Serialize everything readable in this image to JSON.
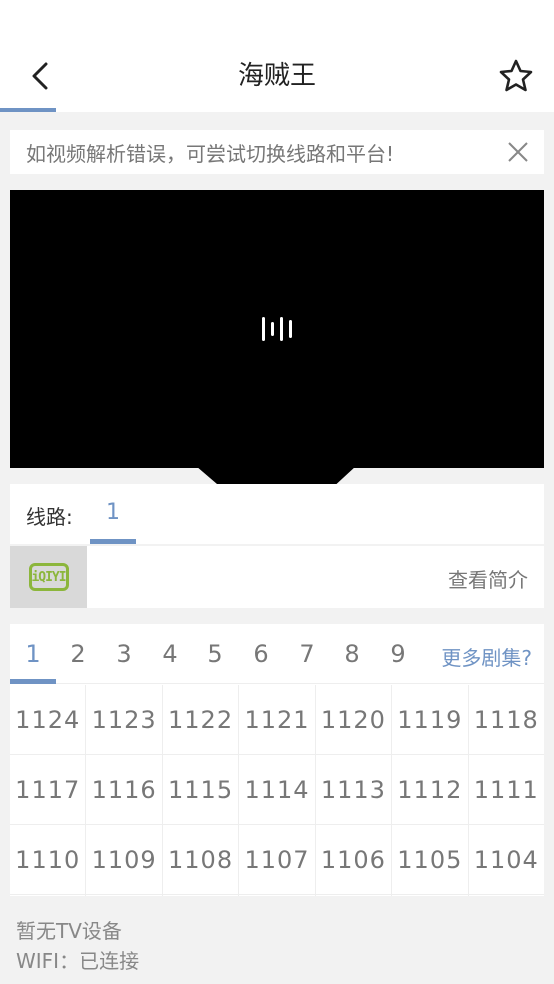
{
  "header": {
    "title": "海贼王",
    "back_icon": "chevron-left-icon",
    "favorite_icon": "star-outline-icon"
  },
  "notice": {
    "text": "如视频解析错误，可尝试切换线路和平台!",
    "close_icon": "close-icon"
  },
  "player": {
    "loader_icon": "loading-bars-icon"
  },
  "line": {
    "label": "线路:",
    "tabs": [
      "1"
    ]
  },
  "platform": {
    "logo_text": "iQIYI",
    "intro": "查看简介"
  },
  "episodes": {
    "pages": [
      "1",
      "2",
      "3",
      "4",
      "5",
      "6",
      "7",
      "8",
      "9"
    ],
    "active_page": "1",
    "more": "更多剧集?",
    "rows": [
      [
        "1124",
        "1123",
        "1122",
        "1121",
        "1120",
        "1119",
        "1118"
      ],
      [
        "1117",
        "1116",
        "1115",
        "1114",
        "1113",
        "1112",
        "1111"
      ],
      [
        "1110",
        "1109",
        "1108",
        "1107",
        "1106",
        "1105",
        "1104"
      ],
      [
        "",
        "",
        "",
        "",
        "",
        "",
        ""
      ]
    ]
  },
  "status": {
    "tv": "暂无TV设备",
    "wifi": "WIFI：已连接"
  },
  "colors": {
    "accent": "#6f93c4",
    "iqiyi": "#8cb63c",
    "player_bg": "#000000"
  }
}
